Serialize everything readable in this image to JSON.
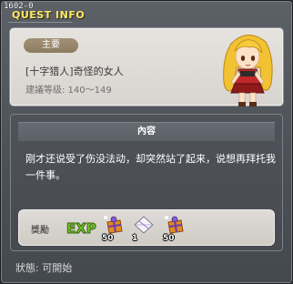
{
  "window": {
    "quest_id": "1602-0",
    "title": "QUEST INFO"
  },
  "header": {
    "badge": "主要",
    "quest_name": "[十字猎人]奇怪的女人",
    "level_text": "建議等级: 140〜149"
  },
  "content": {
    "header_label": "內容",
    "description": "刚才还说受了伤没法动，却突然站了起来，说想再拜托我一件事。",
    "reward_label": "獎勵",
    "exp_label": "EXP",
    "items": [
      {
        "icon": "gift-box-icon",
        "count": "50"
      },
      {
        "icon": "envelope-icon",
        "count": "1"
      },
      {
        "icon": "gift-box-icon",
        "count": "50"
      }
    ]
  },
  "status": "狀態: 可開始",
  "colors": {
    "title": "#ffe86a",
    "badge": "#9a896d",
    "panel_light": "#e0ddd8",
    "panel_dark": "#4b4f55"
  }
}
